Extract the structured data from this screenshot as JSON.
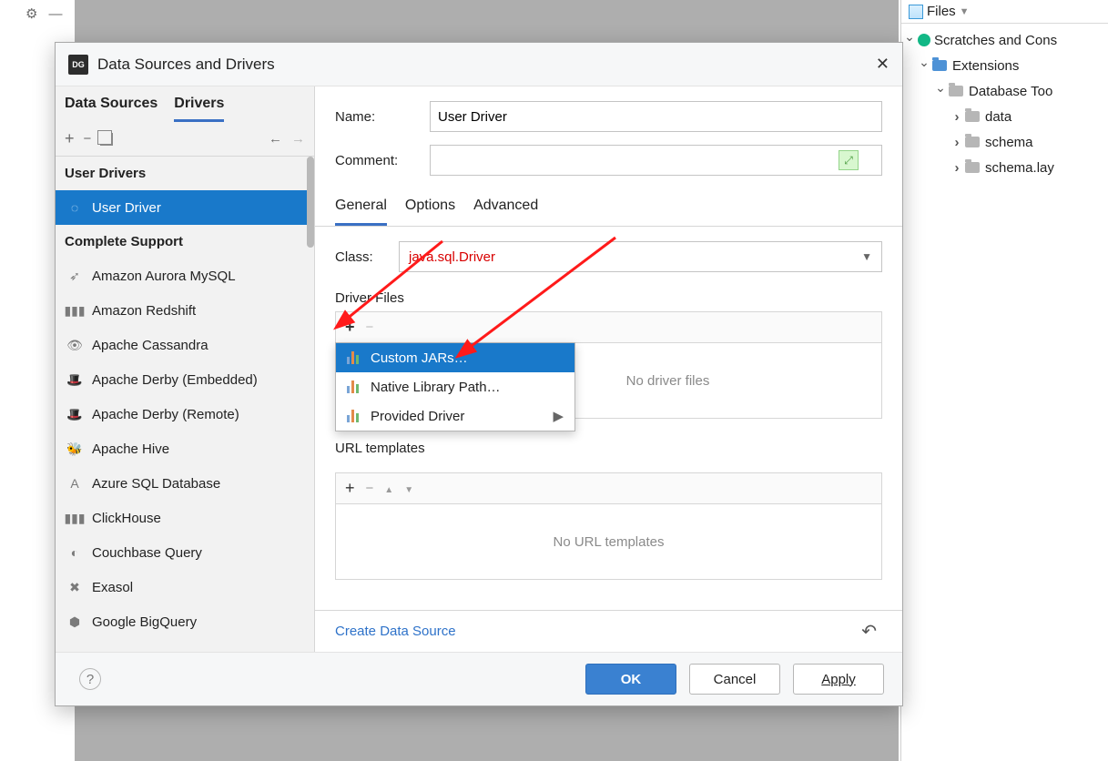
{
  "toolbar": {
    "gear": "⚙",
    "minus": "—"
  },
  "right_panel": {
    "tab_label": "Files",
    "tree": {
      "root": "Scratches and Cons",
      "ext": "Extensions",
      "dbt": "Database Too",
      "children": [
        "data",
        "schema",
        "schema.lay"
      ]
    }
  },
  "dialog": {
    "title": "Data Sources and Drivers",
    "app_icon": "DG",
    "left_tabs": {
      "data_sources": "Data Sources",
      "drivers": "Drivers"
    },
    "sections": {
      "user_drivers": "User Drivers",
      "complete": "Complete Support"
    },
    "user_driver_item": "User Driver",
    "drivers_list": [
      "Amazon Aurora MySQL",
      "Amazon Redshift",
      "Apache Cassandra",
      "Apache Derby (Embedded)",
      "Apache Derby (Remote)",
      "Apache Hive",
      "Azure SQL Database",
      "ClickHouse",
      "Couchbase Query",
      "Exasol",
      "Google BigQuery"
    ],
    "form": {
      "name_label": "Name:",
      "name_value": "User Driver",
      "comment_label": "Comment:",
      "comment_value": ""
    },
    "sub_tabs": {
      "general": "General",
      "options": "Options",
      "advanced": "Advanced"
    },
    "class_row": {
      "label": "Class:",
      "value": "java.sql.Driver"
    },
    "driver_files": {
      "label": "Driver Files",
      "placeholder": "No driver files"
    },
    "popup": {
      "item1": "Custom JARs…",
      "item2": "Native Library Path…",
      "item3": "Provided Driver"
    },
    "url_templates": {
      "label": "URL templates",
      "placeholder": "No URL templates"
    },
    "create_link": "Create Data Source",
    "buttons": {
      "ok": "OK",
      "cancel": "Cancel",
      "apply": "Apply"
    }
  }
}
